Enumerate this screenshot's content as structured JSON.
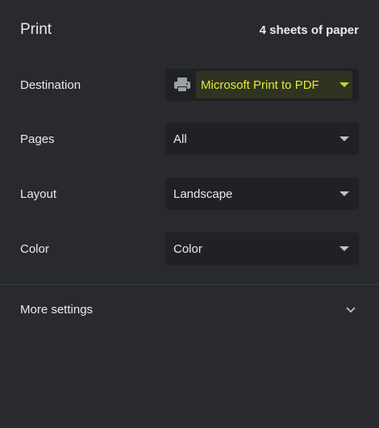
{
  "header": {
    "title": "Print",
    "sheet_count": "4 sheets of paper"
  },
  "destination": {
    "label": "Destination",
    "value": "Microsoft Print to PDF",
    "icon": "printer-icon",
    "highlight_color": "#e2ea3a"
  },
  "pages": {
    "label": "Pages",
    "value": "All"
  },
  "layout": {
    "label": "Layout",
    "value": "Landscape"
  },
  "color": {
    "label": "Color",
    "value": "Color"
  },
  "more_settings": {
    "label": "More settings",
    "icon": "chevron-down-icon"
  },
  "theme": {
    "background": "#292a2d",
    "field_background": "#202124",
    "text": "#e8eaed"
  }
}
